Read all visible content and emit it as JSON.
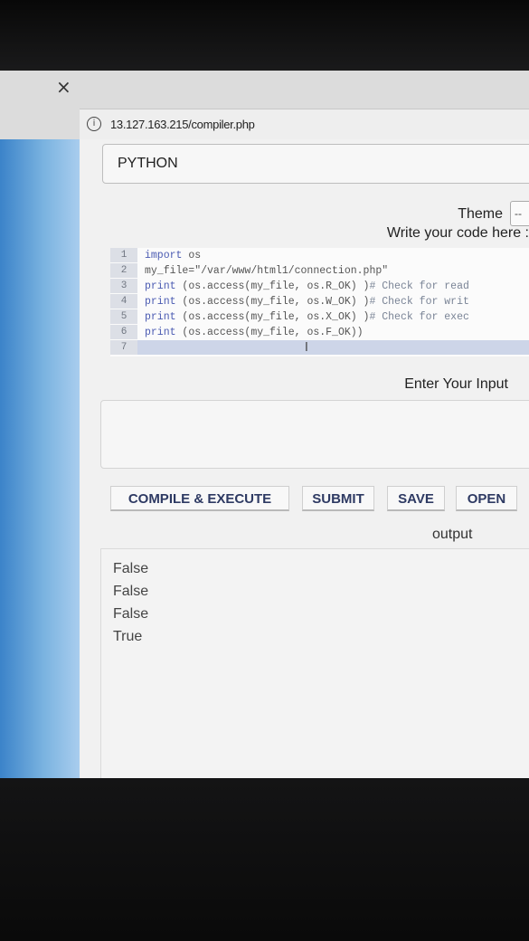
{
  "browser": {
    "close_glyph": "×",
    "info_glyph": "i",
    "url": "13.127.163.215/compiler.php"
  },
  "compiler": {
    "language": "PYTHON",
    "theme_label": "Theme",
    "theme_value": "--",
    "write_label": "Write your code here :",
    "code_lines": [
      {
        "num": "1",
        "tokens": [
          {
            "t": "import",
            "c": "kw"
          },
          {
            "t": " os",
            "c": ""
          }
        ]
      },
      {
        "num": "2",
        "tokens": [
          {
            "t": "my_file=\"/var/www/html1/connection.php\"",
            "c": ""
          }
        ]
      },
      {
        "num": "3",
        "tokens": [
          {
            "t": "print",
            "c": "kw"
          },
          {
            "t": " (os.access(my_file, os.R_OK) )",
            "c": ""
          },
          {
            "t": "# Check for read",
            "c": "cm"
          }
        ]
      },
      {
        "num": "4",
        "tokens": [
          {
            "t": "print",
            "c": "kw"
          },
          {
            "t": " (os.access(my_file, os.W_OK) )",
            "c": ""
          },
          {
            "t": "# Check for writ",
            "c": "cm"
          }
        ]
      },
      {
        "num": "5",
        "tokens": [
          {
            "t": "print",
            "c": "kw"
          },
          {
            "t": " (os.access(my_file, os.X_OK) )",
            "c": ""
          },
          {
            "t": "# Check for exec",
            "c": "cm"
          }
        ]
      },
      {
        "num": "6",
        "tokens": [
          {
            "t": "print",
            "c": "kw"
          },
          {
            "t": " (os.access(my_file, os.F_OK))",
            "c": ""
          }
        ]
      },
      {
        "num": "7",
        "tokens": []
      }
    ],
    "cursor_glyph": "I",
    "input_label": "Enter Your Input",
    "input_value": "",
    "buttons": {
      "compile": "COMPILE & EXECUTE",
      "submit": "SUBMIT",
      "save": "SAVE",
      "open": "OPEN"
    },
    "output_label": "output",
    "output_lines": [
      "False",
      "False",
      "False",
      "True"
    ]
  }
}
